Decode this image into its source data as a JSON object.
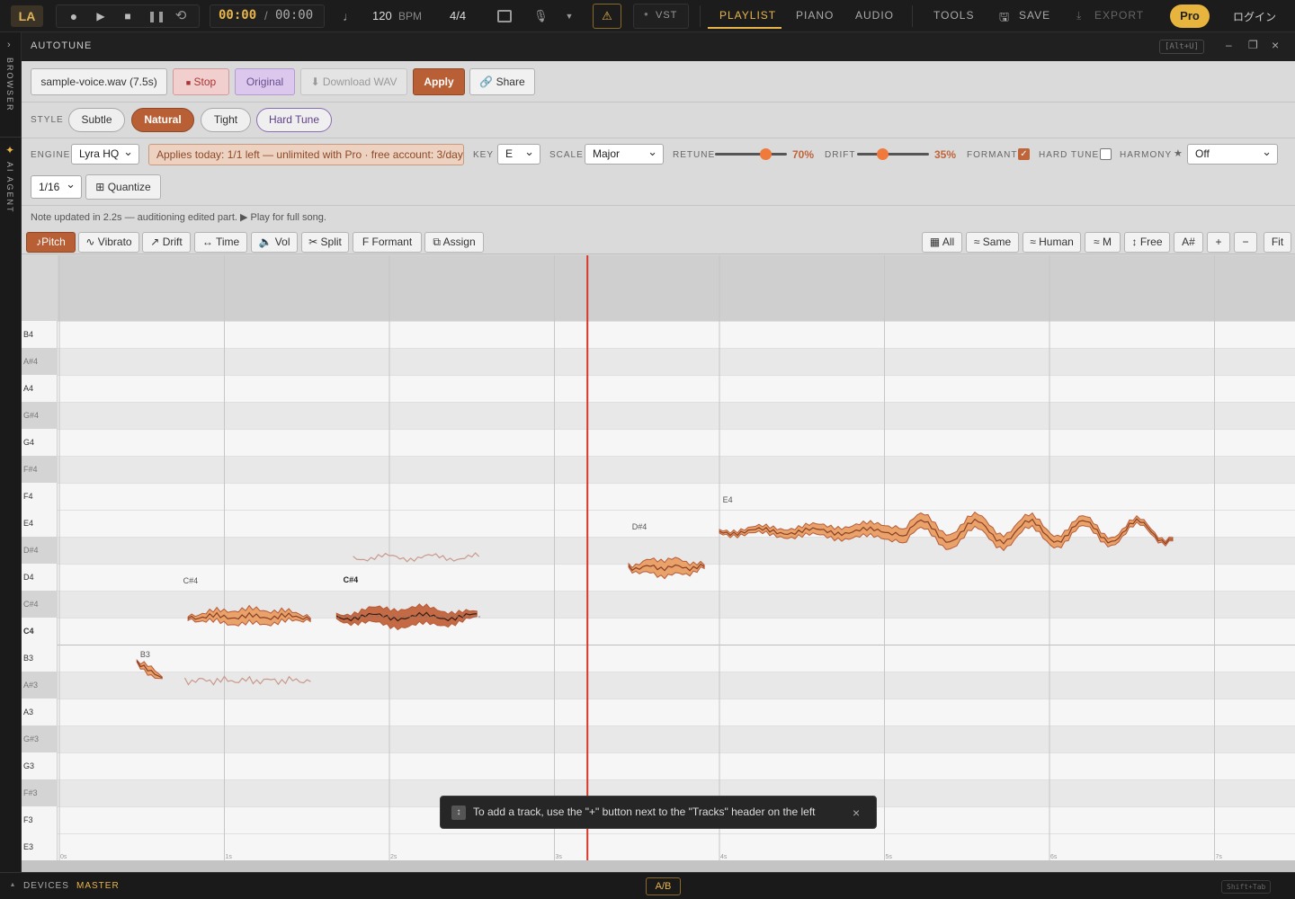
{
  "topbar": {
    "logo": "LA",
    "time_current": "00:00",
    "time_separator": "/",
    "time_total": "00:00",
    "bpm_value": "120",
    "bpm_unit": "BPM",
    "time_signature": "4/4",
    "vst_label": "VST",
    "tabs": [
      "PLAYLIST",
      "PIANO",
      "AUDIO"
    ],
    "active_tab": "PLAYLIST",
    "tools_label": "TOOLS",
    "save_label": "SAVE",
    "export_label": "EXPORT",
    "pro_label": "Pro",
    "login_label": "ログイン"
  },
  "sidebar": {
    "browser_label": "BROWSER",
    "agent_label": "AI AGENT"
  },
  "window": {
    "title": "AUTOTUNE",
    "shortcut": "[Alt+U]"
  },
  "actions": {
    "file_label": "sample-voice.wav (7.5s)",
    "stop_label": "Stop",
    "original_label": "Original",
    "download_label": "Download WAV",
    "apply_label": "Apply",
    "share_label": "Share"
  },
  "style": {
    "label": "STYLE",
    "options": [
      "Subtle",
      "Natural",
      "Tight",
      "Hard Tune"
    ],
    "selected": "Natural"
  },
  "params": {
    "engine_label": "ENGINE",
    "engine_value": "Lyra HQ",
    "quota_text": "Applies today: 1/1 left — unlimited with Pro · free account: 3/day",
    "key_label": "KEY",
    "key_value": "E",
    "scale_label": "SCALE",
    "scale_value": "Major",
    "retune_label": "RETUNE",
    "retune_value": "70%",
    "retune_fraction": 0.7,
    "drift_label": "DRIFT",
    "drift_value": "35%",
    "drift_fraction": 0.35,
    "formant_label": "FORMANT",
    "formant_checked": true,
    "hardtune_label": "HARD TUNE",
    "hardtune_checked": false,
    "harmony_label": "HARMONY",
    "harmony_value": "Off",
    "grid_value": "1/16",
    "quantize_label": "Quantize"
  },
  "status": {
    "message": "Note updated in 2.2s — auditioning edited part. ▶ Play for full song."
  },
  "tools": {
    "left": [
      "Pitch",
      "Vibrato",
      "Drift",
      "Time",
      "Vol",
      "Split",
      "Formant",
      "Assign"
    ],
    "left_icons": [
      "♪",
      "∿",
      "↗",
      "↔",
      "🔈",
      "✂",
      "F",
      "⧉"
    ],
    "active": "Pitch",
    "right": [
      "All",
      "Same",
      "Human",
      "M",
      "Free",
      "A#",
      "+",
      "−",
      "Fit"
    ],
    "right_icons": [
      "▦",
      "≈",
      "≈",
      "≈",
      "↕",
      "",
      "",
      "",
      ""
    ]
  },
  "keys": [
    "B4",
    "A#4",
    "A4",
    "G#4",
    "G4",
    "F#4",
    "F4",
    "E4",
    "D#4",
    "D4",
    "C#4",
    "C4",
    "B3",
    "A#3",
    "A3",
    "G#3",
    "G3",
    "F#3",
    "F3",
    "E3"
  ],
  "time_labels": [
    "0s",
    "1s",
    "2s",
    "3s",
    "4s",
    "5s",
    "6s",
    "7s"
  ],
  "notes": [
    "B3",
    "C#4",
    "C#4",
    "D#4",
    "E4"
  ],
  "toast": {
    "message": "To add a track, use the \"+\" button next to the \"Tracks\" header on the left"
  },
  "bottombar": {
    "devices_label": "DEVICES",
    "master_label": "MASTER",
    "ab_label": "A/B",
    "shortcut": "Shift+Tab"
  },
  "colors": {
    "accent": "#c0643a",
    "playhead": "#d9362c",
    "note_fill": "#e8a26a",
    "note_core": "#f0c878",
    "pro": "#e7b43d"
  }
}
